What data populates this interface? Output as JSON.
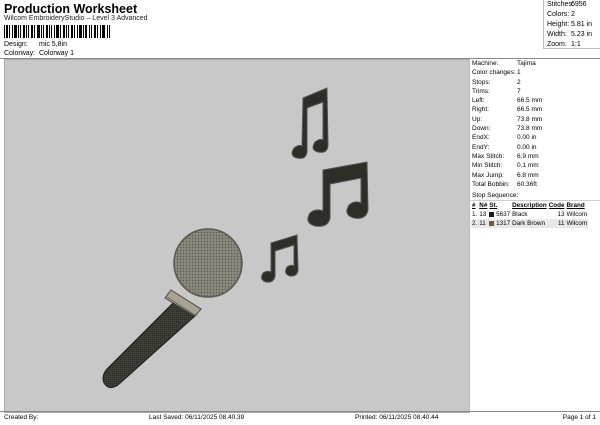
{
  "header": {
    "title": "Production Worksheet",
    "subtitle": "Wilcom EmbroideryStudio – Level 3 Advanced",
    "design_label": "Design:",
    "design_value": "mic 5,8in",
    "colorway_label": "Colorway:",
    "colorway_value": "Colorway 1"
  },
  "stats": {
    "stitches_label": "Stitches:",
    "stitches_value": "6956",
    "colors_label": "Colors:",
    "colors_value": "2",
    "height_label": "Height:",
    "height_value": "5.81 in",
    "width_label": "Width:",
    "width_value": "5.23 in",
    "zoom_label": "Zoom:",
    "zoom_value": "1:1"
  },
  "machine_info": [
    {
      "label": "Machine:",
      "value": "Tajima"
    },
    {
      "label": "Color changes:",
      "value": "1"
    },
    {
      "label": "Stops:",
      "value": "2"
    },
    {
      "label": "Trims:",
      "value": "7"
    },
    {
      "label": "Left:",
      "value": "66.5 mm"
    },
    {
      "label": "Right:",
      "value": "66.5 mm"
    },
    {
      "label": "Up:",
      "value": "73.8 mm"
    },
    {
      "label": "Down:",
      "value": "73.8 mm"
    },
    {
      "label": "EndX:",
      "value": "0.00 in"
    },
    {
      "label": "EndY:",
      "value": "0.00 in"
    },
    {
      "label": "Max Stitch:",
      "value": "6.9 mm"
    },
    {
      "label": "Min Stitch:",
      "value": "0.1 mm"
    },
    {
      "label": "Max Jump:",
      "value": "6.8 mm"
    },
    {
      "label": "Total Bobbin:",
      "value": "60.36ft"
    }
  ],
  "stop_sequence": {
    "title": "Stop Sequence:",
    "columns": [
      "#",
      "N#",
      "St.",
      "Description",
      "Code",
      "Brand"
    ],
    "rows": [
      {
        "num": "1.",
        "n": "13",
        "st": "5637",
        "swatch": "#1a1a1a",
        "description": "Black",
        "code": "13",
        "brand": "Wilcom"
      },
      {
        "num": "2.",
        "n": "11",
        "st": "1317",
        "swatch": "#6b5a48",
        "description": "Dark Brown",
        "code": "11",
        "brand": "Wilcom"
      }
    ]
  },
  "footer": {
    "created_by": "Created By:",
    "last_saved": "Last Saved: 06/11/2025 08.40.39",
    "printed": "Printed: 06/11/2025 08.40.44",
    "page": "Page 1 of 1"
  },
  "colors": {
    "design_background": "#c8c8c8",
    "thread_black": "#2e2e28",
    "thread_brown": "#6b5a48",
    "mesh": "#8a877c",
    "ring": "#a9a396"
  },
  "icons": [
    "barcode-icon",
    "microphone-icon",
    "music-note-icon"
  ]
}
